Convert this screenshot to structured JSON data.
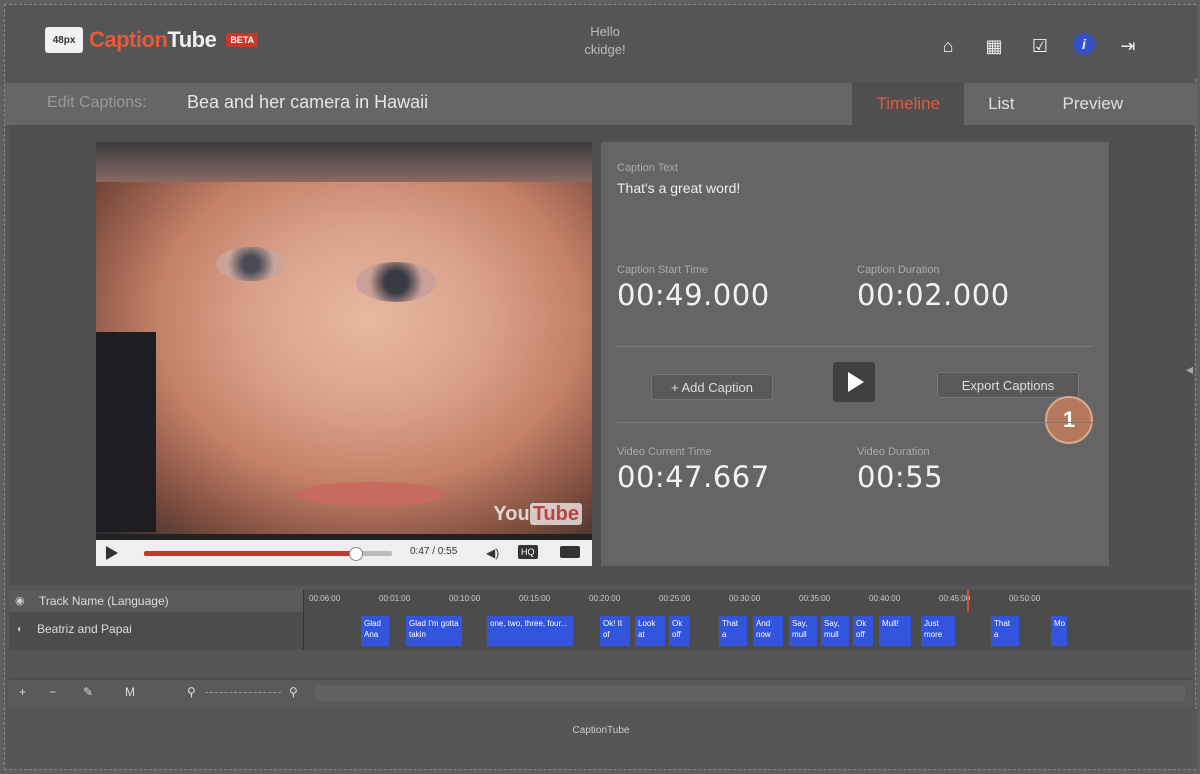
{
  "app": {
    "logo_box": "48px",
    "logo_name_1": "Caption",
    "logo_name_2": "Tube",
    "logo_badge": "BETA",
    "greeting_line1": "Hello",
    "greeting_line2": "ckidge!"
  },
  "header_icons": [
    "home-icon",
    "film-icon",
    "clipboard-icon",
    "info-icon",
    "logout-icon"
  ],
  "title_row": {
    "edit_label": "Edit Captions:",
    "video_title": "Bea and her camera in Hawaii",
    "tabs": [
      {
        "label": "Timeline",
        "active": true
      },
      {
        "label": "List",
        "active": false
      },
      {
        "label": "Preview",
        "active": false
      }
    ]
  },
  "player": {
    "watermark_1": "You",
    "watermark_2": "Tube",
    "time": "0:47 / 0:55",
    "quality": "HQ",
    "progress": 0.85
  },
  "caption": {
    "text_label": "Caption Text",
    "text": "That's a great word!",
    "start_label": "Caption Start Time",
    "start": "00:49.000",
    "duration_label": "Caption Duration",
    "duration": "00:02.000",
    "add_button": "+ Add Caption",
    "export_button": "Export Captions",
    "callout": "1",
    "current_label": "Video Current Time",
    "current": "00:47.667",
    "video_duration_label": "Video Duration",
    "video_duration": "00:55"
  },
  "timeline": {
    "header": "Track Name (Language)",
    "track": "Beatriz and Papai",
    "ticks": [
      "00:06:00",
      "00:01:00",
      "00:10:00",
      "00:15:00",
      "00:20:00",
      "00:25:00",
      "00:30:00",
      "00:35:00",
      "00:40:00",
      "00:45:00",
      "00:50:00"
    ],
    "cues": [
      {
        "text": "Glad Ana"
      },
      {
        "text": "Glad I'm gotta takin"
      },
      {
        "text": "one, two, three, four..."
      },
      {
        "text": "Ok! It of"
      },
      {
        "text": "Look at"
      },
      {
        "text": "Ok off"
      },
      {
        "text": "That a"
      },
      {
        "text": "And now"
      },
      {
        "text": "Say, mull"
      },
      {
        "text": "Say, mull"
      },
      {
        "text": "Ok off"
      },
      {
        "text": "Mull!"
      },
      {
        "text": "Just more"
      },
      {
        "text": "That a"
      },
      {
        "text": "Mo"
      }
    ],
    "tools": [
      "+",
      "−",
      "✎",
      "M"
    ]
  },
  "footer": {
    "text": "CaptionTube"
  }
}
